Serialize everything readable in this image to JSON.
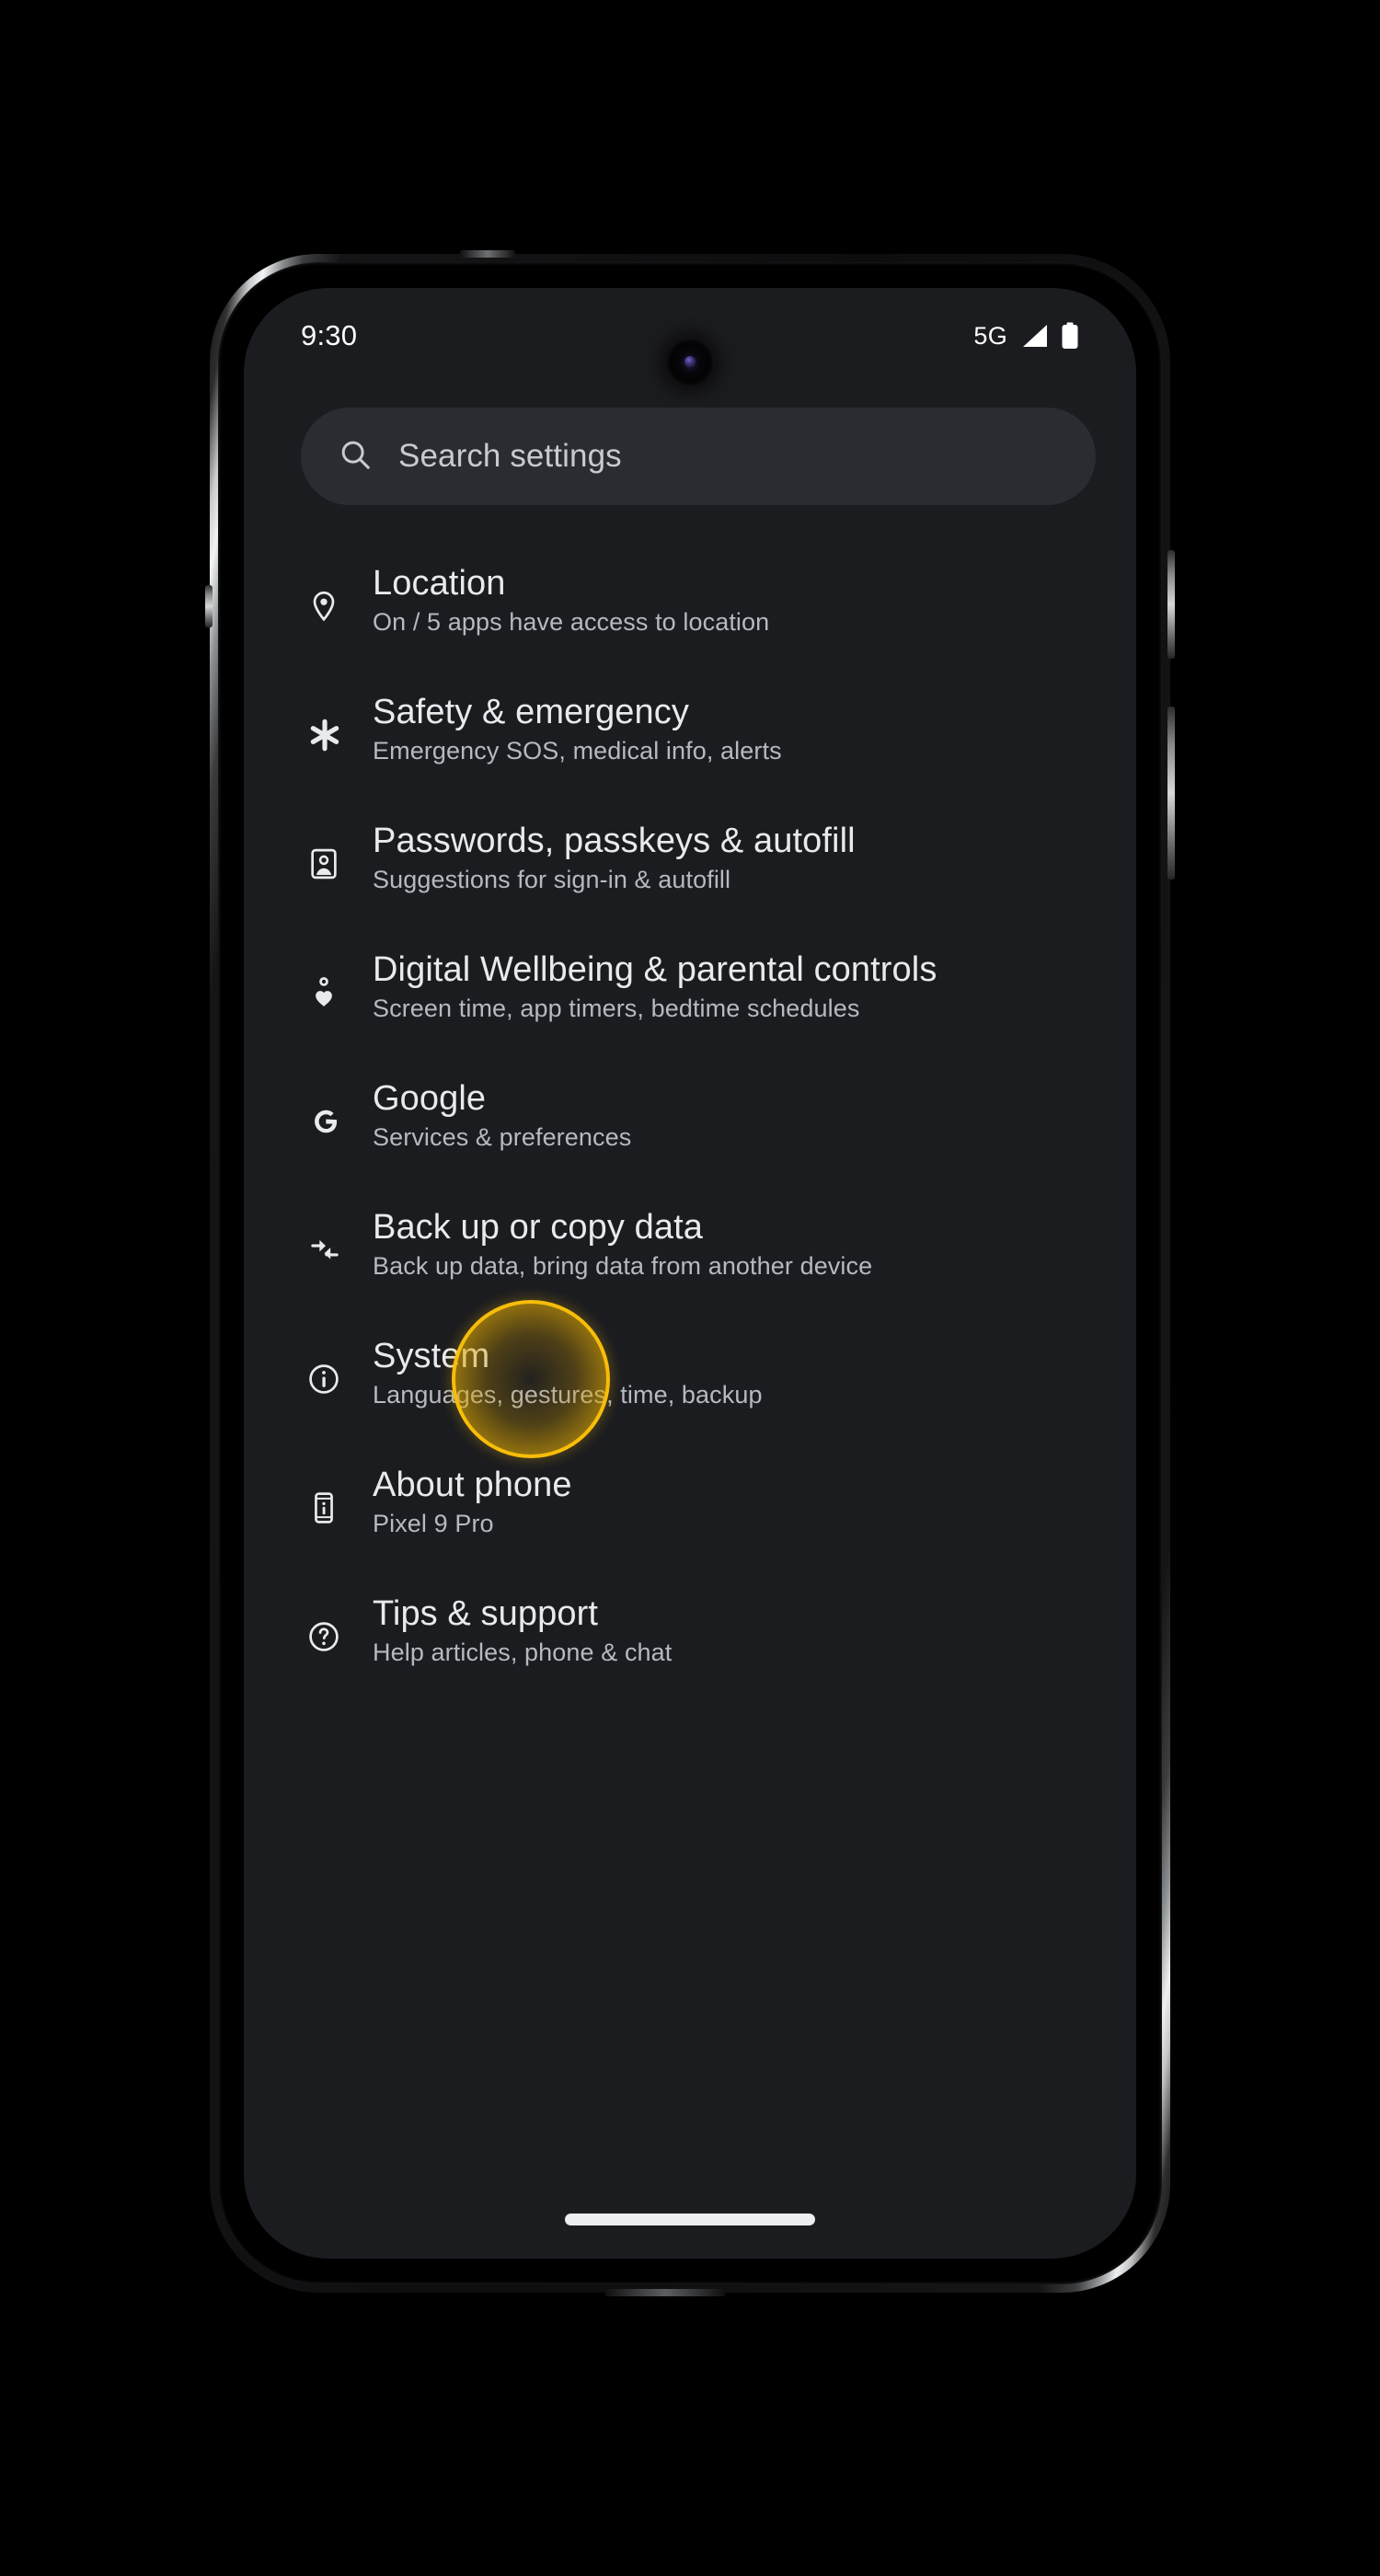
{
  "status_bar": {
    "time": "9:30",
    "network": "5G",
    "signal_icon": "signal-bars-icon",
    "battery_icon": "battery-full-icon"
  },
  "search": {
    "icon": "search-icon",
    "placeholder": "Search settings",
    "value": ""
  },
  "colors": {
    "screen_background": "#1b1c20",
    "search_background": "#2b2c31",
    "title_text": "#e9eaee",
    "subtitle_text": "#b7b9c0",
    "highlight_ring": "#f7bd09",
    "highlight_fill": "#c49200",
    "nav_pill": "#eceef0"
  },
  "settings_list": {
    "items": [
      {
        "icon": "location-pin-icon",
        "title": "Location",
        "subtitle": "On / 5 apps have access to location",
        "highlighted": false
      },
      {
        "icon": "asterisk-safety-icon",
        "title": "Safety & emergency",
        "subtitle": "Emergency SOS, medical info, alerts",
        "highlighted": false
      },
      {
        "icon": "passkey-badge-icon",
        "title": "Passwords, passkeys & autofill",
        "subtitle": "Suggestions for sign-in & autofill",
        "highlighted": false
      },
      {
        "icon": "wellbeing-heart-person-icon",
        "title": "Digital Wellbeing & parental controls",
        "subtitle": "Screen time, app timers, bedtime schedules",
        "highlighted": false
      },
      {
        "icon": "google-g-icon",
        "title": "Google",
        "subtitle": "Services & preferences",
        "highlighted": false
      },
      {
        "icon": "transfer-arrows-icon",
        "title": "Back up or copy data",
        "subtitle": "Back up data, bring data from another device",
        "highlighted": false
      },
      {
        "icon": "info-circle-icon",
        "title": "System",
        "subtitle": "Languages, gestures, time, backup",
        "highlighted": true
      },
      {
        "icon": "phone-info-icon",
        "title": "About phone",
        "subtitle": "Pixel 9 Pro",
        "highlighted": false
      },
      {
        "icon": "help-circle-icon",
        "title": "Tips & support",
        "subtitle": "Help articles, phone & chat",
        "highlighted": false
      }
    ]
  },
  "navigation": {
    "gesture_pill": "home-gesture-pill"
  },
  "device": {
    "camera": "front-camera-punch-hole",
    "buttons": [
      "volume-up",
      "power",
      "volume-down"
    ]
  }
}
